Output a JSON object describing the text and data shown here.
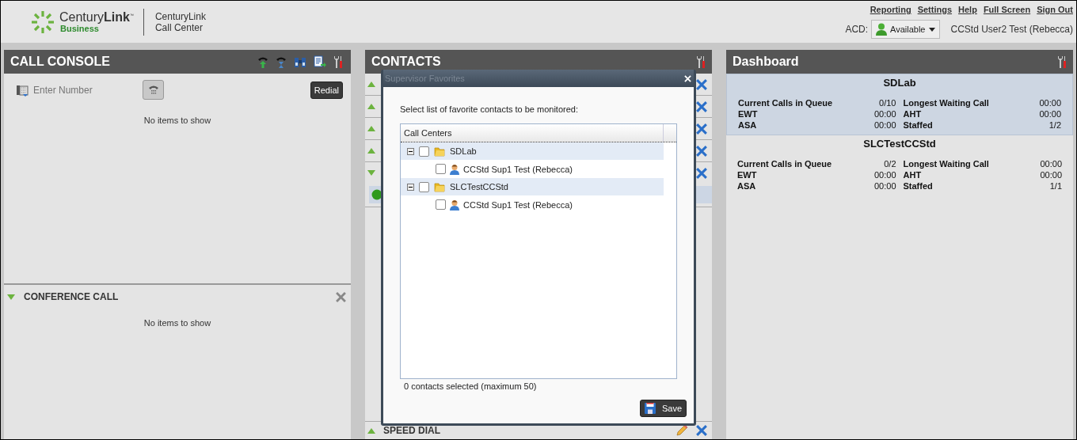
{
  "header": {
    "logo_brand": "Century**Link**$^{™}$",
    "logo_sub": "Business",
    "app_title": [
      "CenturyLink",
      "Call Center"
    ],
    "links": [
      "Reporting",
      "Settings",
      "Help",
      "Full Screen",
      "Sign Out"
    ],
    "acd_label": "ACD:",
    "acd_status": "Available",
    "user": "CCStd User2 Test (Rebecca)"
  },
  "call_console": {
    "title": "CALL CONSOLE",
    "placeholder": "Enter Number",
    "redial": "Redial",
    "empty": "No items to show",
    "conference": {
      "title": "CONFERENCE CALL",
      "expanded": true,
      "empty": "No items to show"
    }
  },
  "contacts": {
    "title": "CONTACTS",
    "sections": [
      {
        "expanded": false
      },
      {
        "expanded": false
      },
      {
        "expanded": false
      },
      {
        "expanded": false
      },
      {
        "expanded": true
      }
    ],
    "speed_dial": {
      "label": "SPEED DIAL",
      "expanded": false,
      "editable": true
    }
  },
  "modal": {
    "title": "Supervisor Favorites",
    "prompt": "Select list of favorite contacts to be monitored:",
    "column": "Call Centers",
    "tree": [
      {
        "label": "SDLab",
        "expanded": true,
        "checked": false,
        "children": [
          {
            "label": "CCStd Sup1 Test (Rebecca)",
            "checked": false
          }
        ]
      },
      {
        "label": "SLCTestCCStd",
        "expanded": true,
        "checked": false,
        "children": [
          {
            "label": "CCStd Sup1 Test (Rebecca)",
            "checked": false
          }
        ]
      }
    ],
    "footer": "0 contacts selected (maximum 50)",
    "save": "Save"
  },
  "dashboard": {
    "title": "Dashboard",
    "centers": [
      {
        "name": "SDLab",
        "selected": true,
        "stats": [
          {
            "label": "Current Calls in Queue",
            "value": "0/10"
          },
          {
            "label": "Longest Waiting Call",
            "value": "00:00"
          },
          {
            "label": "EWT",
            "value": "00:00"
          },
          {
            "label": "AHT",
            "value": "00:00"
          },
          {
            "label": "ASA",
            "value": "00:00"
          },
          {
            "label": "Staffed",
            "value": "1/2"
          }
        ]
      },
      {
        "name": "SLCTestCCStd",
        "selected": false,
        "stats": [
          {
            "label": "Current Calls in Queue",
            "value": "0/2"
          },
          {
            "label": "Longest Waiting Call",
            "value": "00:00"
          },
          {
            "label": "EWT",
            "value": "00:00"
          },
          {
            "label": "AHT",
            "value": "00:00"
          },
          {
            "label": "ASA",
            "value": "00:00"
          },
          {
            "label": "Staffed",
            "value": "1/1"
          }
        ]
      }
    ]
  }
}
